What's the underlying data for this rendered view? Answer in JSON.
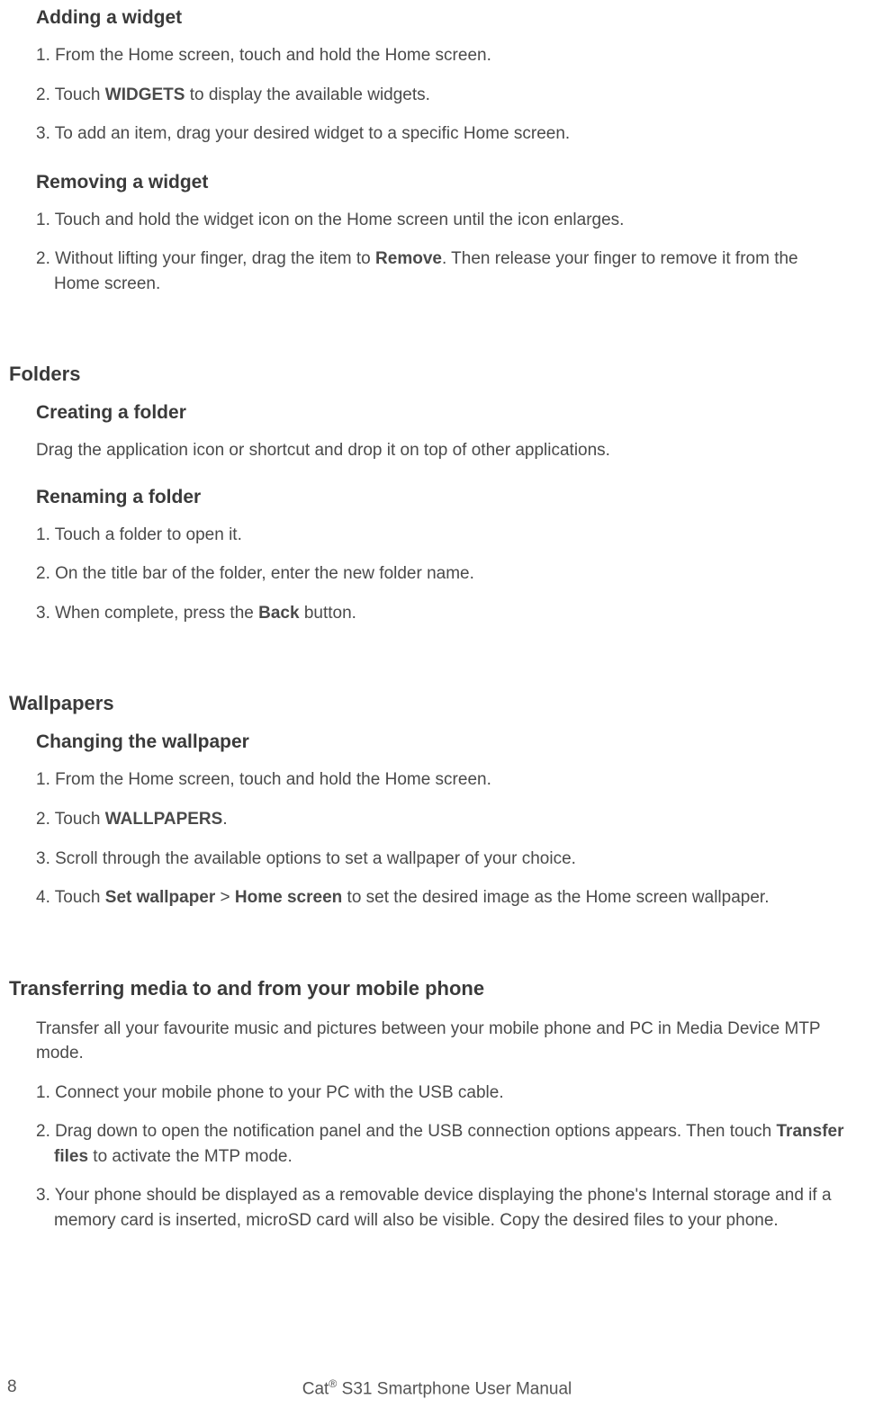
{
  "sections": {
    "adding_widget": {
      "title": "Adding a widget",
      "steps": {
        "s1_pre": "1. From the Home screen, touch and hold the Home screen.",
        "s2_pre": "2. Touch ",
        "s2_bold": "WIDGETS",
        "s2_post": " to display the available widgets.",
        "s3": "3. To add an item, drag your desired widget to a specific Home screen."
      }
    },
    "removing_widget": {
      "title": "Removing a widget",
      "steps": {
        "s1": "1. Touch and hold the widget icon on the Home screen until the icon enlarges.",
        "s2_pre": "2. Without lifting your finger, drag the item to ",
        "s2_bold": "Remove",
        "s2_post": ". Then release your finger to remove it from the Home screen."
      }
    },
    "folders": {
      "title": "Folders",
      "creating": {
        "title": "Creating a folder",
        "text": "Drag the application icon or shortcut and drop it on top of other applications."
      },
      "renaming": {
        "title": "Renaming a folder",
        "steps": {
          "s1": "1. Touch a folder to open it.",
          "s2": "2. On the title bar of the folder, enter the new folder name.",
          "s3_pre": "3. When complete, press the ",
          "s3_bold": "Back",
          "s3_post": " button."
        }
      }
    },
    "wallpapers": {
      "title": "Wallpapers",
      "changing": {
        "title": "Changing the wallpaper",
        "steps": {
          "s1": "1. From the Home screen, touch and hold the Home screen.",
          "s2_pre": "2. Touch ",
          "s2_bold": "WALLPAPERS",
          "s2_post": ".",
          "s3": "3. Scroll through the available options to set a wallpaper of your choice.",
          "s4_pre": "4. Touch ",
          "s4_bold1": "Set wallpaper",
          "s4_mid": " > ",
          "s4_bold2": "Home screen",
          "s4_post": " to set the desired image as the Home screen wallpaper."
        }
      }
    },
    "transferring": {
      "title": "Transferring media to and from your mobile phone",
      "intro": "Transfer all your favourite music and pictures between your mobile phone and PC in Media Device MTP mode.",
      "steps": {
        "s1": "1. Connect your mobile phone to your PC with the USB cable.",
        "s2_pre": "2. Drag down to open the notification panel and the USB connection options appears. Then touch ",
        "s2_bold": "Transfer files",
        "s2_post": " to activate the MTP mode.",
        "s3": "3. Your phone should be displayed as a removable device displaying the phone's Internal storage and if a memory card is inserted, microSD card will also be visible. Copy the desired files to your phone."
      }
    }
  },
  "footer": {
    "page_number": "8",
    "title_pre": "Cat",
    "title_reg": "®",
    "title_post": " S31 Smartphone User Manual"
  }
}
